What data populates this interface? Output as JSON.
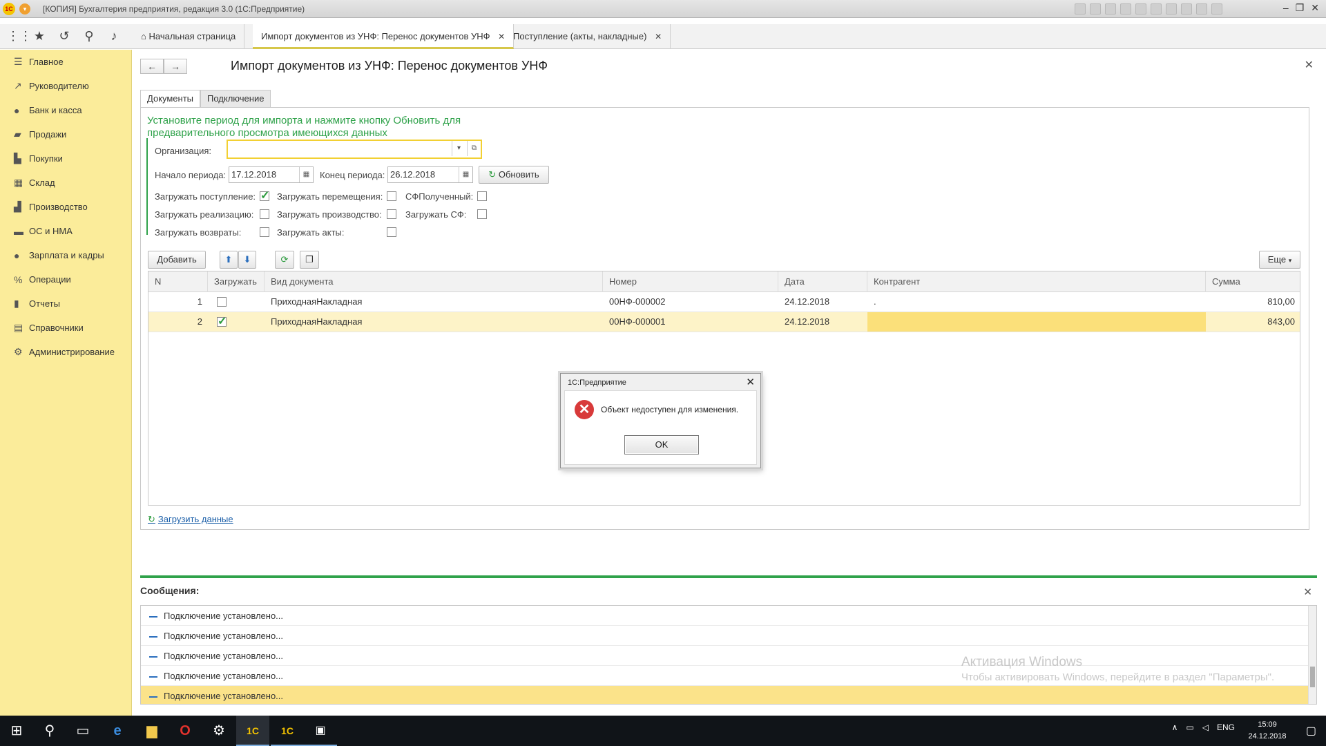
{
  "window": {
    "title": "[КОПИЯ] Бухгалтерия предприятия, редакция 3.0 (1С:Предприятие)",
    "logo_text": "1С"
  },
  "tabs": [
    {
      "label": "Начальная страница"
    },
    {
      "label": "Импорт документов из УНФ: Перенос документов УНФ"
    },
    {
      "label": "Поступление (акты, накладные)"
    }
  ],
  "sidebar": {
    "items": [
      {
        "label": "Главное",
        "icon": "menu-icon"
      },
      {
        "label": "Руководителю",
        "icon": "chart-icon"
      },
      {
        "label": "Банк и касса",
        "icon": "ruble-icon"
      },
      {
        "label": "Продажи",
        "icon": "bag-icon"
      },
      {
        "label": "Покупки",
        "icon": "cart-icon"
      },
      {
        "label": "Склад",
        "icon": "grid-icon"
      },
      {
        "label": "Производство",
        "icon": "factory-icon"
      },
      {
        "label": "ОС и НМА",
        "icon": "truck-icon"
      },
      {
        "label": "Зарплата и кадры",
        "icon": "person-icon"
      },
      {
        "label": "Операции",
        "icon": "operations-icon"
      },
      {
        "label": "Отчеты",
        "icon": "bar-chart-icon"
      },
      {
        "label": "Справочники",
        "icon": "book-icon"
      },
      {
        "label": "Администрирование",
        "icon": "gear-icon"
      }
    ]
  },
  "form": {
    "title": "Импорт документов из УНФ: Перенос документов УНФ",
    "tab_documents": "Документы",
    "tab_connection": "Подключение",
    "hint": "Установите период для импорта и нажмите кнопку Обновить для предварительного просмотра имеющихся данных",
    "org_label": "Организация:",
    "org_value": "",
    "period_start_label": "Начало периода:",
    "period_start": "17.12.2018",
    "period_end_label": "Конец периода:",
    "period_end": "26.12.2018",
    "refresh_label": "Обновить",
    "checkboxes": {
      "load_receipts": {
        "label": "Загружать поступление:",
        "checked": true
      },
      "load_transfers": {
        "label": "Загружать перемещения:",
        "checked": false
      },
      "sf_received": {
        "label": "СФПолученный:",
        "checked": false
      },
      "load_sales": {
        "label": "Загружать реализацию:",
        "checked": false
      },
      "load_production": {
        "label": "Загружать производство:",
        "checked": false
      },
      "load_sf": {
        "label": "Загружать СФ:",
        "checked": false
      },
      "load_returns": {
        "label": "Загружать возвраты:",
        "checked": false
      },
      "load_acts": {
        "label": "Загружать акты:",
        "checked": false
      }
    },
    "add_label": "Добавить",
    "more_label": "Еще",
    "load_link": "Загрузить данные"
  },
  "table": {
    "columns": [
      "N",
      "Загружать",
      "Вид документа",
      "Номер",
      "Дата",
      "Контрагент",
      "Сумма"
    ],
    "rows": [
      {
        "n": "1",
        "load": false,
        "doc_type": "ПриходнаяНакладная",
        "number": "00НФ-000002",
        "date": "24.12.2018",
        "counterparty": ".",
        "sum": "810,00",
        "selected": false
      },
      {
        "n": "2",
        "load": true,
        "doc_type": "ПриходнаяНакладная",
        "number": "00НФ-000001",
        "date": "24.12.2018",
        "counterparty": "",
        "sum": "843,00",
        "selected": true
      }
    ]
  },
  "messages": {
    "title": "Сообщения:",
    "items": [
      "Подключение установлено...",
      "Подключение установлено...",
      "Подключение установлено...",
      "Подключение установлено...",
      "Подключение установлено..."
    ]
  },
  "dialog": {
    "title": "1С:Предприятие",
    "message": "Объект недоступен для изменения.",
    "ok_label": "OK"
  },
  "watermark": {
    "line1": "Активация Windows",
    "line2": "Чтобы активировать Windows, перейдите в раздел \"Параметры\"."
  },
  "taskbar": {
    "lang": "ENG",
    "time": "15:09",
    "date": "24.12.2018"
  }
}
